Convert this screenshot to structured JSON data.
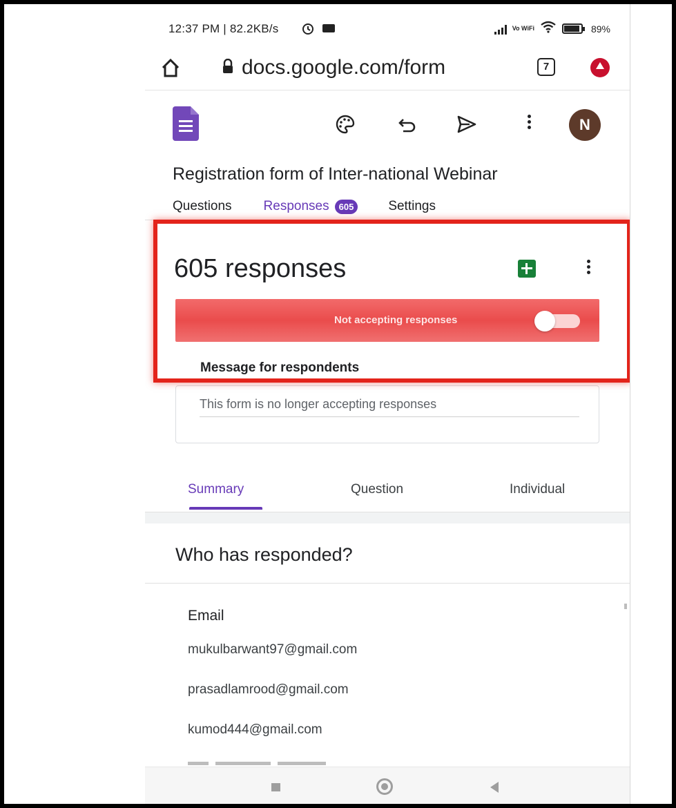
{
  "status_bar": {
    "time_speed": "12:37 PM | 82.2KB/s",
    "network_label": "Vo WiFi",
    "battery_percent": "89%"
  },
  "browser": {
    "url": "docs.google.com/form",
    "tab_count": "7",
    "icons": [
      "home-icon",
      "lock-icon",
      "extension-icon"
    ]
  },
  "toolbar": {
    "icons": [
      "forms-logo",
      "palette-icon",
      "undo-icon",
      "send-icon",
      "more-vert-icon"
    ],
    "avatar_initial": "N"
  },
  "form": {
    "title": "Registration form of Inter-national Webinar"
  },
  "top_tabs": {
    "questions": "Questions",
    "responses": "Responses",
    "responses_count": "605",
    "settings": "Settings"
  },
  "responses": {
    "count_label": "605 responses",
    "accepting_label": "Not accepting responses",
    "accepting": false,
    "message_label": "Message for respondents",
    "message_value": "This form is no longer accepting responses"
  },
  "sub_tabs": {
    "summary": "Summary",
    "question": "Question",
    "individual": "Individual"
  },
  "who": {
    "title": "Who has responded?",
    "column_label": "Email",
    "emails": [
      "mukulbarwant97@gmail.com",
      "prasadlamrood@gmail.com",
      "kumod444@gmail.com"
    ]
  },
  "colors": {
    "accent": "#673ab7",
    "highlight": "#e3241b",
    "banner": "#ea4c4c",
    "sheets": "#188038"
  }
}
